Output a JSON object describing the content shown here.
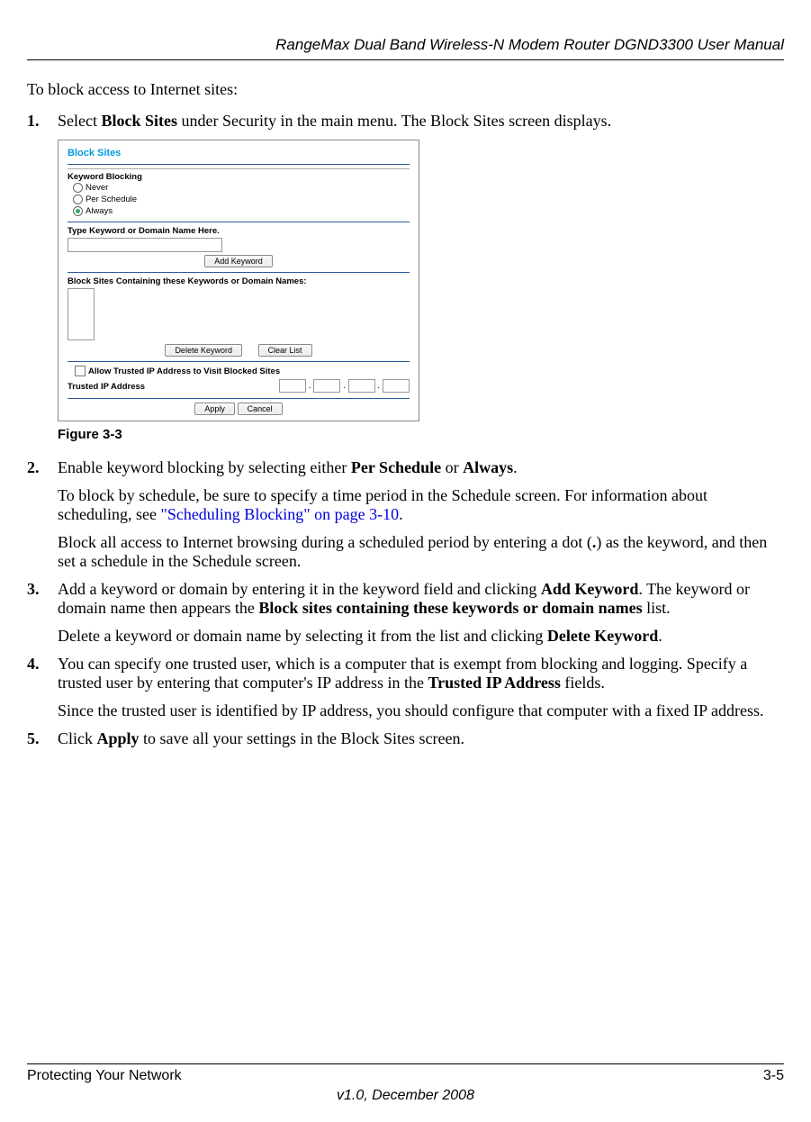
{
  "header": {
    "title": "RangeMax Dual Band Wireless-N Modem Router DGND3300 User Manual"
  },
  "intro": "To block access to Internet sites:",
  "steps": {
    "s1": {
      "num": "1.",
      "text_a": "Select ",
      "bold_a": "Block Sites",
      "text_b": " under Security in the main menu. The Block Sites screen displays."
    },
    "s2": {
      "num": "2.",
      "text_a": "Enable keyword blocking by selecting either ",
      "bold_a": "Per Schedule",
      "text_b": " or ",
      "bold_b": "Always",
      "text_c": ".",
      "p2_a": "To block by schedule, be sure to specify a time period in the Schedule screen. For information about scheduling, see ",
      "p2_link": "\"Scheduling Blocking\" on page 3-10",
      "p2_b": ".",
      "p3_a": "Block all access to Internet browsing during a scheduled period by entering a dot (",
      "p3_bold": ".",
      "p3_b": ") as the keyword, and then set a schedule in the Schedule screen."
    },
    "s3": {
      "num": "3.",
      "text_a": "Add a keyword or domain by entering it in the keyword field and clicking ",
      "bold_a": "Add Keyword",
      "text_b": ". The keyword or domain name then appears the ",
      "bold_b": "Block sites containing these keywords or domain names",
      "text_c": " list.",
      "p2_a": "Delete a keyword or domain name by selecting it from the list and clicking ",
      "p2_bold": "Delete Keyword",
      "p2_b": "."
    },
    "s4": {
      "num": "4.",
      "text_a": "You can specify one trusted user, which is a computer that is exempt from blocking and logging. Specify a trusted user by entering that computer's IP address in the ",
      "bold_a": "Trusted IP Address",
      "text_b": " fields.",
      "p2": "Since the trusted user is identified by IP address, you should configure that computer with a fixed IP address."
    },
    "s5": {
      "num": "5.",
      "text_a": "Click ",
      "bold_a": "Apply",
      "text_b": " to save all your settings in the Block Sites screen."
    }
  },
  "figure": {
    "caption": "Figure 3-3",
    "screen": {
      "title": "Block Sites",
      "keyword_blocking_label": "Keyword Blocking",
      "opt_never": "Never",
      "opt_per_schedule": "Per Schedule",
      "opt_always": "Always",
      "type_keyword_label": "Type Keyword or Domain Name Here.",
      "add_keyword_btn": "Add Keyword",
      "block_list_label": "Block Sites Containing these Keywords or Domain Names:",
      "delete_keyword_btn": "Delete Keyword",
      "clear_list_btn": "Clear List",
      "allow_trusted_label": "Allow Trusted IP Address to Visit Blocked Sites",
      "trusted_ip_label": "Trusted IP Address",
      "apply_btn": "Apply",
      "cancel_btn": "Cancel"
    }
  },
  "footer": {
    "left": "Protecting Your Network",
    "right": "3-5",
    "version": "v1.0, December 2008"
  }
}
